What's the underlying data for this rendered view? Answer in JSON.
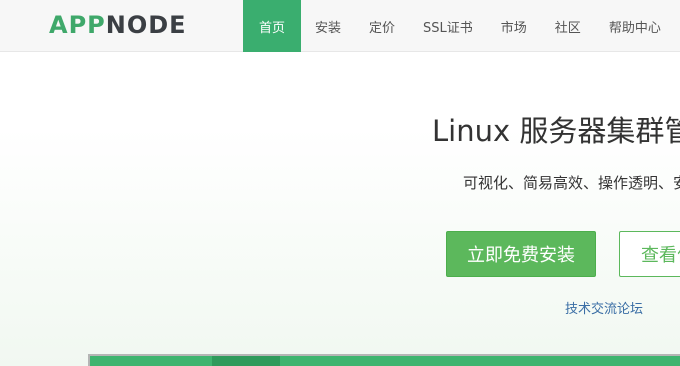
{
  "header": {
    "logo": {
      "part1": "APP",
      "part2": "NODE"
    },
    "nav": [
      {
        "label": "首页",
        "active": true
      },
      {
        "label": "安装",
        "active": false
      },
      {
        "label": "定价",
        "active": false
      },
      {
        "label": "SSL证书",
        "active": false
      },
      {
        "label": "市场",
        "active": false
      },
      {
        "label": "社区",
        "active": false
      },
      {
        "label": "帮助中心",
        "active": false
      }
    ]
  },
  "hero": {
    "title": "Linux 服务器集群管理",
    "subtitle": "可视化、简易高效、操作透明、安全",
    "primary_button": "立即免费安装",
    "secondary_button": "查看价格",
    "forum_link": "技术交流论坛"
  },
  "colors": {
    "brand_green": "#3aae6f",
    "button_green": "#5cb85c",
    "logo_dark": "#3b3f44",
    "link_blue": "#3a6ea5"
  }
}
